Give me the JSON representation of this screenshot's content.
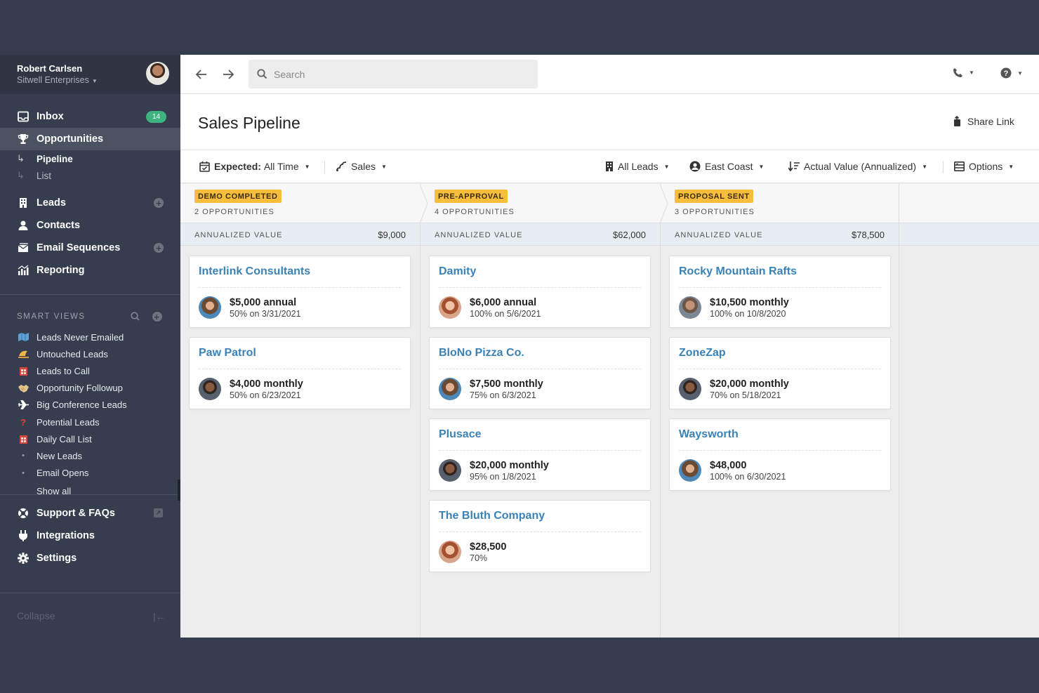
{
  "user": {
    "name": "Robert Carlsen",
    "org": "Sitwell Enterprises"
  },
  "nav": {
    "inbox": {
      "label": "Inbox",
      "badge": "14"
    },
    "opportunities": {
      "label": "Opportunities"
    },
    "pipeline": {
      "label": "Pipeline"
    },
    "list": {
      "label": "List"
    },
    "leads": {
      "label": "Leads"
    },
    "contacts": {
      "label": "Contacts"
    },
    "email_sequences": {
      "label": "Email Sequences"
    },
    "reporting": {
      "label": "Reporting"
    }
  },
  "smart_views": {
    "title": "SMART VIEWS",
    "items": [
      {
        "label": "Leads Never Emailed",
        "icon": "map-icon"
      },
      {
        "label": "Untouched Leads",
        "icon": "sleep-icon"
      },
      {
        "label": "Leads to Call",
        "icon": "phone-booth-icon"
      },
      {
        "label": "Opportunity Followup",
        "icon": "handshake-icon"
      },
      {
        "label": "Big Conference Leads",
        "icon": "airplane-icon"
      },
      {
        "label": "Potential Leads",
        "icon": "question-icon"
      },
      {
        "label": "Daily Call List",
        "icon": "phone-booth-icon"
      },
      {
        "label": "New Leads",
        "icon": "dot-icon"
      },
      {
        "label": "Email Opens",
        "icon": "dot-icon"
      },
      {
        "label": "Show all",
        "icon": ""
      }
    ]
  },
  "bottom_nav": {
    "support": {
      "label": "Support & FAQs"
    },
    "integrations": {
      "label": "Integrations"
    },
    "settings": {
      "label": "Settings"
    },
    "collapse": {
      "label": "Collapse"
    }
  },
  "search": {
    "placeholder": "Search"
  },
  "page": {
    "title": "Sales Pipeline",
    "share_label": "Share Link"
  },
  "filters": {
    "expected_key": "Expected:",
    "expected_value": "All Time",
    "pipeline": "Sales",
    "leads": "All Leads",
    "territory": "East Coast",
    "sort": "Actual Value (Annualized)",
    "options": "Options"
  },
  "columns": [
    {
      "stage": "DEMO COMPLETED",
      "count": "2 OPPORTUNITIES",
      "annual_label": "ANNUALIZED VALUE",
      "annual_value": "$9,000",
      "cards": [
        {
          "name": "Interlink Consultants",
          "amount": "$5,000 annual",
          "detail": "50% on 3/31/2021"
        },
        {
          "name": "Paw Patrol",
          "amount": "$4,000 monthly",
          "detail": "50% on 6/23/2021"
        }
      ]
    },
    {
      "stage": "PRE-APPROVAL",
      "count": "4 OPPORTUNITIES",
      "annual_label": "ANNUALIZED VALUE",
      "annual_value": "$62,000",
      "cards": [
        {
          "name": "Damity",
          "amount": "$6,000 annual",
          "detail": "100% on 5/6/2021"
        },
        {
          "name": "BloNo Pizza Co.",
          "amount": "$7,500 monthly",
          "detail": "75% on 6/3/2021"
        },
        {
          "name": "Plusace",
          "amount": "$20,000 monthly",
          "detail": "95% on 1/8/2021"
        },
        {
          "name": "The Bluth Company",
          "amount": "$28,500",
          "detail": "70%"
        }
      ]
    },
    {
      "stage": "PROPOSAL SENT",
      "count": "3 OPPORTUNITIES",
      "annual_label": "ANNUALIZED VALUE",
      "annual_value": "$78,500",
      "cards": [
        {
          "name": "Rocky Mountain Rafts",
          "amount": "$10,500 monthly",
          "detail": "100% on 10/8/2020"
        },
        {
          "name": "ZoneZap",
          "amount": "$20,000 monthly",
          "detail": "70% on 5/18/2021"
        },
        {
          "name": "Waysworth",
          "amount": "$48,000",
          "detail": "100% on 6/30/2021"
        }
      ]
    }
  ],
  "colors": {
    "accent": "#3a82b5",
    "stage_badge": "#f6be3c",
    "sidebar": "#363d4e",
    "badge_green": "#3fb37f"
  }
}
